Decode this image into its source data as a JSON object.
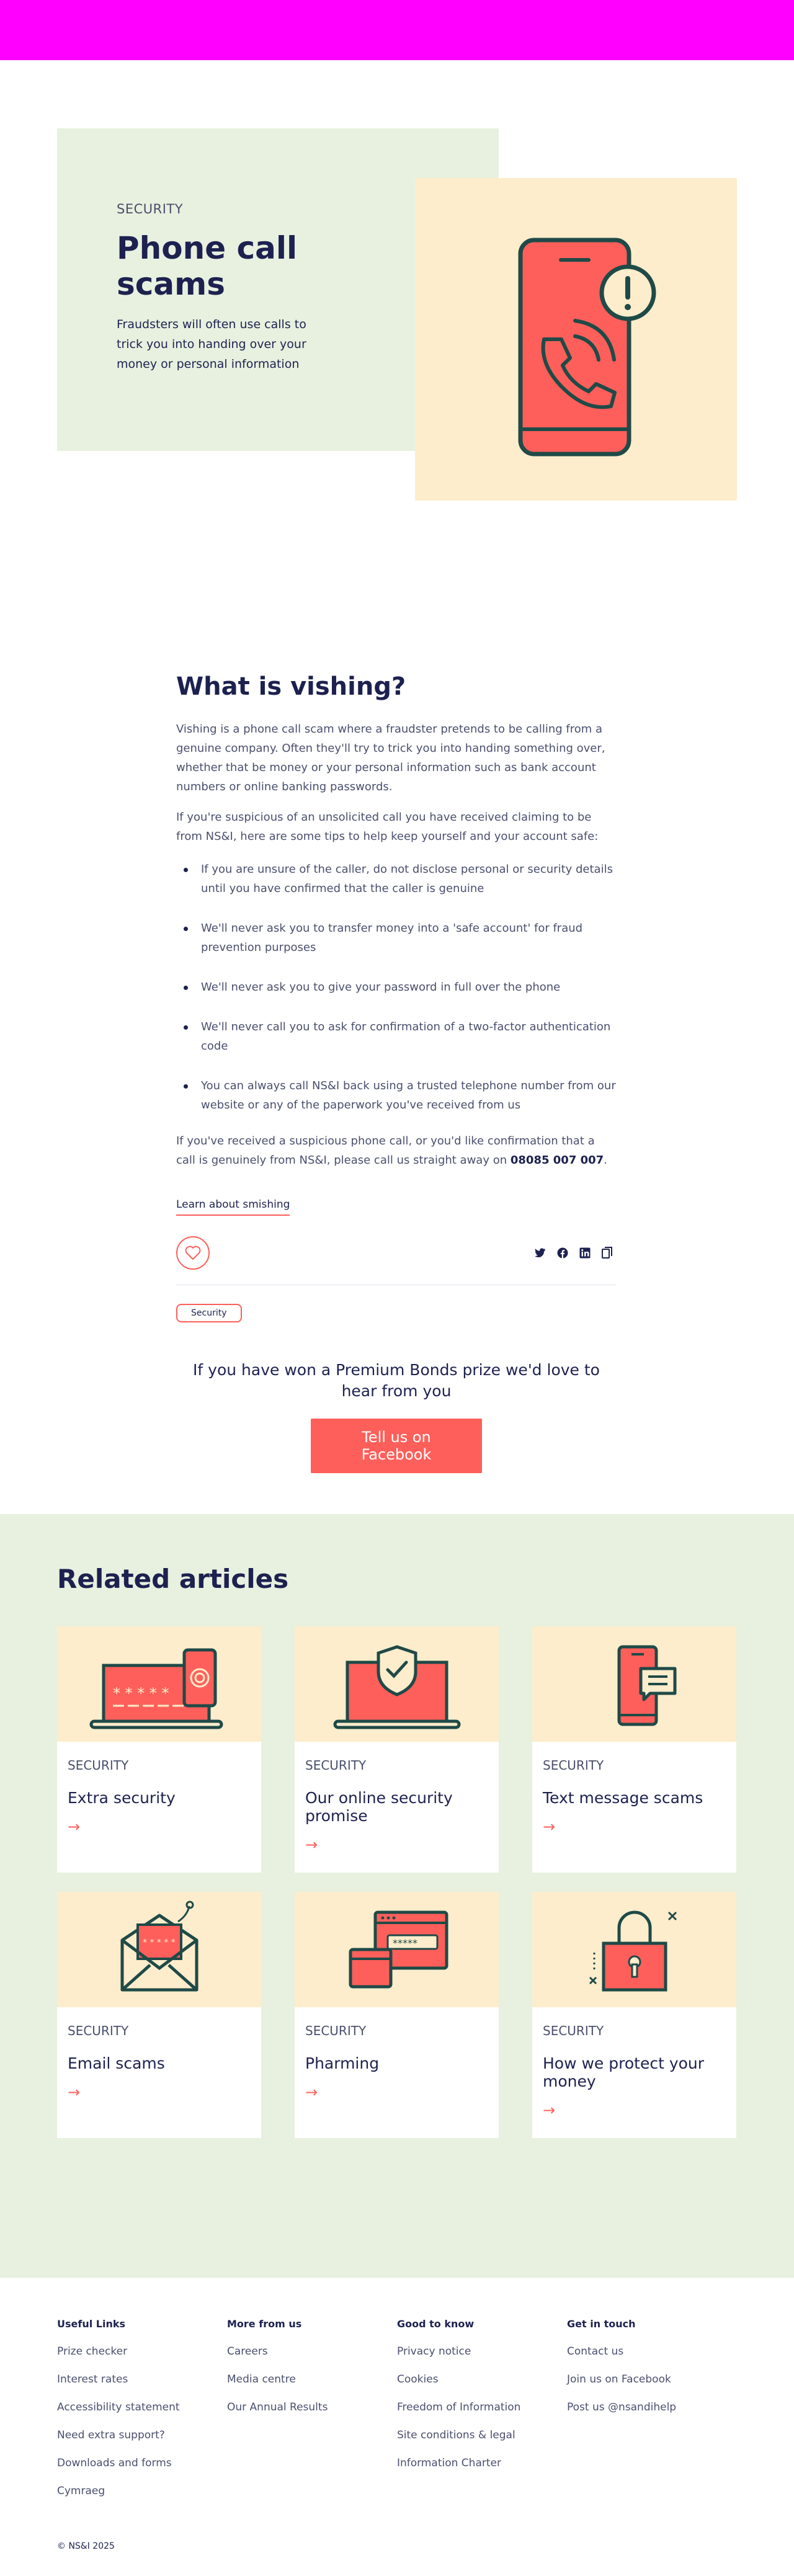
{
  "hero": {
    "eyebrow": "SECURITY",
    "title": "Phone call scams",
    "description": "Fraudsters will often use calls to trick you into handing over your money or personal information"
  },
  "article": {
    "heading": "What is vishing?",
    "intro": "Vishing is a phone call scam where a fraudster pretends to be calling from a genuine company. Often they'll try to trick you into handing something over, whether that be money or your personal information such as bank account numbers or online banking passwords.",
    "suspicious": "If you're suspicious of an unsolicited call you have received claiming to be from NS&I, here are some tips to help keep yourself and your account safe:",
    "tips": [
      "If you are unsure of the caller, do not disclose personal or security details until you have confirmed that the caller is genuine",
      "We'll never ask you to transfer money into a 'safe account' for fraud prevention purposes",
      "We'll never ask you to give your password in full over the phone",
      "We'll never call you to ask for confirmation of a two-factor authentication code",
      "You can always call NS&I back using a trusted telephone number from our website or any of the paperwork you've received from us"
    ],
    "closing": "If you've received a suspicious phone call, or you'd like confirmation that a call is genuinely from NS&I, please call us straight away on",
    "phone": "08085 007 007",
    "period": ".",
    "smishing_link": "Learn about smishing",
    "tag": "Security"
  },
  "share": {
    "icons": [
      "heart-icon",
      "twitter-icon",
      "facebook-icon",
      "linkedin-icon",
      "copy-icon"
    ]
  },
  "cta": {
    "text": "If you have won a Premium Bonds prize we'd love to hear from you",
    "button": "Tell us on Facebook"
  },
  "related": {
    "title": "Related articles",
    "cards": [
      {
        "eyebrow": "SECURITY",
        "title": "Extra security",
        "icon": "laptop-fingerprint-icon"
      },
      {
        "eyebrow": "SECURITY",
        "title": "Our online security promise",
        "icon": "laptop-shield-icon"
      },
      {
        "eyebrow": "SECURITY",
        "title": "Text message scams",
        "icon": "phone-message-icon"
      },
      {
        "eyebrow": "SECURITY",
        "title": "Email scams",
        "icon": "envelope-hook-icon"
      },
      {
        "eyebrow": "SECURITY",
        "title": "Pharming",
        "icon": "browser-password-icon"
      },
      {
        "eyebrow": "SECURITY",
        "title": "How we protect your money",
        "icon": "padlock-icon"
      }
    ],
    "arrow": "→"
  },
  "footer": {
    "columns": [
      {
        "heading": "Useful Links",
        "links": [
          "Prize checker",
          "Interest rates",
          "Accessibility statement",
          "Need extra support?",
          "Downloads and forms",
          "Cymraeg"
        ]
      },
      {
        "heading": "More from us",
        "links": [
          "Careers",
          "Media centre",
          "Our Annual Results"
        ]
      },
      {
        "heading": "Good to know",
        "links": [
          "Privacy notice",
          "Cookies",
          "Freedom of Information",
          "Site conditions & legal",
          "Information Charter"
        ]
      },
      {
        "heading": "Get in touch",
        "links": [
          "Contact us",
          "Join us on Facebook",
          "Post us @nsandihelp"
        ]
      }
    ],
    "copyright": "© NS&I 2025"
  },
  "colors": {
    "accent": "#ff5f5a",
    "navy": "#1d2150",
    "green_bg": "#e8f0df",
    "cream_bg": "#fdedcc",
    "topbar": "#ff00ff"
  }
}
